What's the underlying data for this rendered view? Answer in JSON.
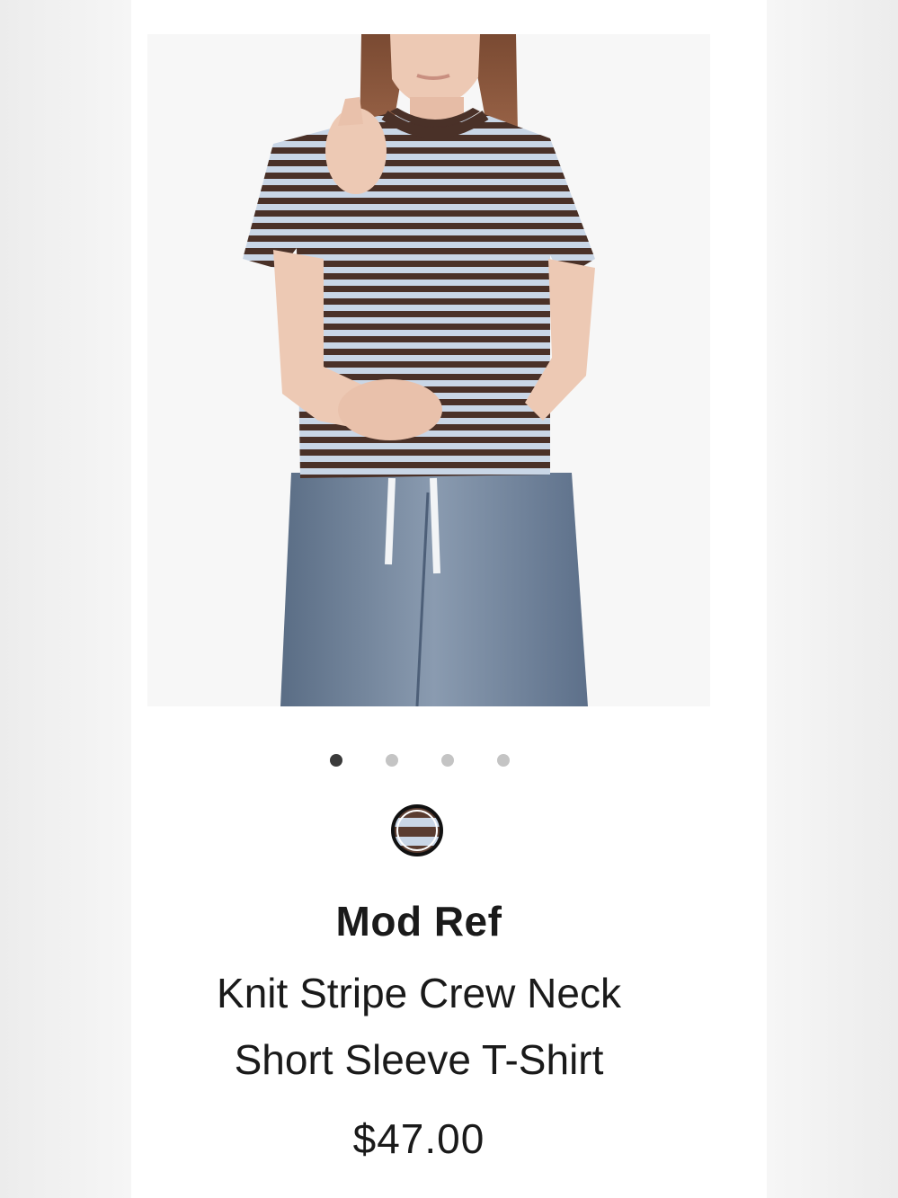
{
  "product": {
    "brand": "Mod Ref",
    "title_line1": "Knit Stripe Crew Neck",
    "title_line2": "Short Sleeve T-Shirt",
    "price": "$47.00",
    "image_alt": "Model wearing brown and light blue striped crew neck t-shirt with jeans"
  },
  "gallery": {
    "total_images": 4,
    "active_index": 0
  },
  "colors": {
    "stripe_brown": "#4a3128",
    "stripe_blue": "#c9d6e6",
    "denim": "#6b7f99",
    "dot_active": "#3a3a3a",
    "dot_inactive": "#c4c4c4"
  },
  "swatch": {
    "selected": true,
    "icon": "striped-color-swatch"
  }
}
